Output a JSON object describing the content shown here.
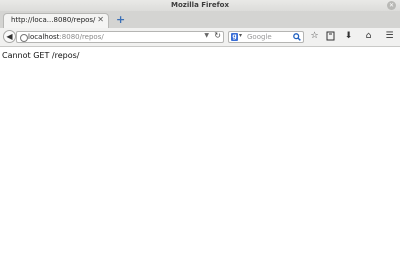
{
  "window": {
    "title": "Mozilla Firefox"
  },
  "tabs": [
    {
      "title": "http://loca...8080/repos/"
    }
  ],
  "navbar": {
    "url_host": "localhost",
    "url_rest": ":8080/repos/",
    "search_engine": "g",
    "search_placeholder": "Google"
  },
  "icons": {
    "back": "back-arrow-icon",
    "reload": "reload-icon",
    "search": "search-icon",
    "bookmark": "star-icon",
    "library": "bookmarks-menu-icon",
    "downloads": "download-icon",
    "home": "home-icon",
    "menu": "hamburger-menu-icon"
  },
  "page": {
    "message": "Cannot GET /repos/"
  },
  "colors": {
    "accent": "#3b6fb6"
  }
}
